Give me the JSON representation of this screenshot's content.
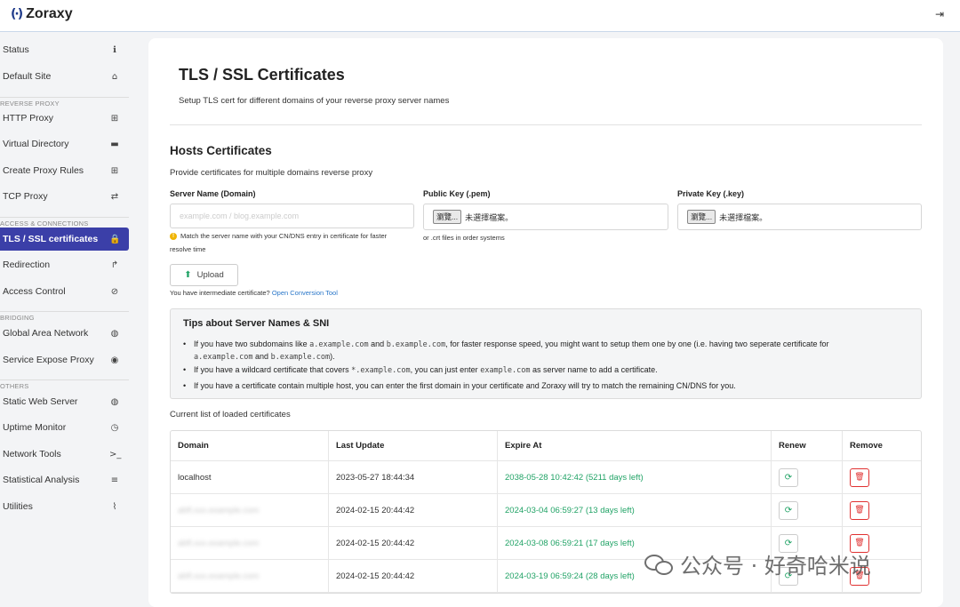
{
  "app": {
    "brand": "Zoraxy",
    "logo_glyph": "(·)",
    "logout_glyph": "⇥"
  },
  "sidebar": {
    "items": [
      {
        "label": "Status",
        "icon": "info-icon",
        "glyph": "ℹ"
      },
      {
        "label": "Default Site",
        "icon": "home-icon",
        "glyph": "⌂"
      },
      {
        "label": "HTTP Proxy",
        "icon": "sitemap-icon",
        "glyph": "⊞"
      },
      {
        "label": "Virtual Directory",
        "icon": "folder-icon",
        "glyph": "▬"
      },
      {
        "label": "Create Proxy Rules",
        "icon": "plus-square-icon",
        "glyph": "⊞"
      },
      {
        "label": "TCP Proxy",
        "icon": "exchange-icon",
        "glyph": "⇄"
      },
      {
        "label": "TLS / SSL certificates",
        "icon": "lock-icon",
        "glyph": "🔒",
        "active": true
      },
      {
        "label": "Redirection",
        "icon": "level-up-icon",
        "glyph": "↱"
      },
      {
        "label": "Access Control",
        "icon": "ban-icon",
        "glyph": "⊘"
      },
      {
        "label": "Global Area Network",
        "icon": "globe-icon",
        "glyph": "◍"
      },
      {
        "label": "Service Expose Proxy",
        "icon": "podcast-icon",
        "glyph": "◉"
      },
      {
        "label": "Static Web Server",
        "icon": "globe-icon",
        "glyph": "◍"
      },
      {
        "label": "Uptime Monitor",
        "icon": "clock-icon",
        "glyph": "◷"
      },
      {
        "label": "Network Tools",
        "icon": "terminal-icon",
        "glyph": ">_"
      },
      {
        "label": "Statistical Analysis",
        "icon": "database-icon",
        "glyph": "≡"
      },
      {
        "label": "Utilities",
        "icon": "paperclip-icon",
        "glyph": "⌇"
      }
    ],
    "sections": [
      "REVERSE PROXY",
      "ACCESS & CONNECTIONS",
      "BRIDGING",
      "OTHERS"
    ]
  },
  "main": {
    "title": "TLS / SSL Certificates",
    "subtitle": "Setup TLS cert for different domains of your reverse proxy server names",
    "hosts_title": "Hosts Certificates",
    "hosts_desc": "Provide certificates for multiple domains reverse proxy",
    "server_name_label": "Server Name (Domain)",
    "server_name_placeholder": "example.com / blog.example.com",
    "server_name_hint": "Match the server name with your CN/DNS entry in certificate for faster resolve time",
    "public_key_label": "Public Key (.pem)",
    "private_key_label": "Private Key (.key)",
    "browse_label": "瀏覽...",
    "no_file_label": "未選擇檔案。",
    "public_key_hint": "or .crt files in order systems",
    "upload_label": "Upload",
    "intermediate_text": "You have intermediate certificate?",
    "conversion_link": "Open Conversion Tool",
    "tips": {
      "title": "Tips about Server Names & SNI",
      "tip1_a": "If you have two subdomains like",
      "tip1_code1": "a.example.com",
      "tip1_and": "and",
      "tip1_code2": "b.example.com",
      "tip1_b": ", for faster response speed, you might want to setup them one by one (i.e. having two seperate certificate for",
      "tip1_code3": "a.example.com",
      "tip1_and2": "and",
      "tip1_code4": "b.example.com",
      "tip1_end": ").",
      "tip2_a": "If you have a wildcard certificate that covers",
      "tip2_code1": "*.example.com",
      "tip2_b": ", you can just enter",
      "tip2_code2": "example.com",
      "tip2_c": "as server name to add a certificate.",
      "tip3": "If you have a certificate contain multiple host, you can enter the first domain in your certificate and Zoraxy will try to match the remaining CN/DNS for you."
    },
    "current_list_label": "Current list of loaded certificates",
    "table": {
      "headers": [
        "Domain",
        "Last Update",
        "Expire At",
        "Renew",
        "Remove"
      ],
      "rows": [
        {
          "domain": "localhost",
          "last_update": "2023-05-27 18:44:34",
          "expire": "2038-05-28 10:42:42 (5211 days left)"
        },
        {
          "domain": "abfl.xxx.example.com",
          "last_update": "2024-02-15 20:44:42",
          "expire": "2024-03-04 06:59:27 (13 days left)"
        },
        {
          "domain": "abfl.xxx.example.com",
          "last_update": "2024-02-15 20:44:42",
          "expire": "2024-03-08 06:59:21 (17 days left)"
        },
        {
          "domain": "abfl.xxx.example.com",
          "last_update": "2024-02-15 20:44:42",
          "expire": "2024-03-19 06:59:24 (28 days left)"
        }
      ],
      "renew_glyph": "⟳",
      "remove_glyph": "🗑"
    }
  },
  "watermark": {
    "text": "公众号 · 好奇哈米说"
  },
  "colors": {
    "accent": "#3b3fa8",
    "success": "#21a366",
    "danger": "#e03131",
    "link": "#2a77c9"
  }
}
